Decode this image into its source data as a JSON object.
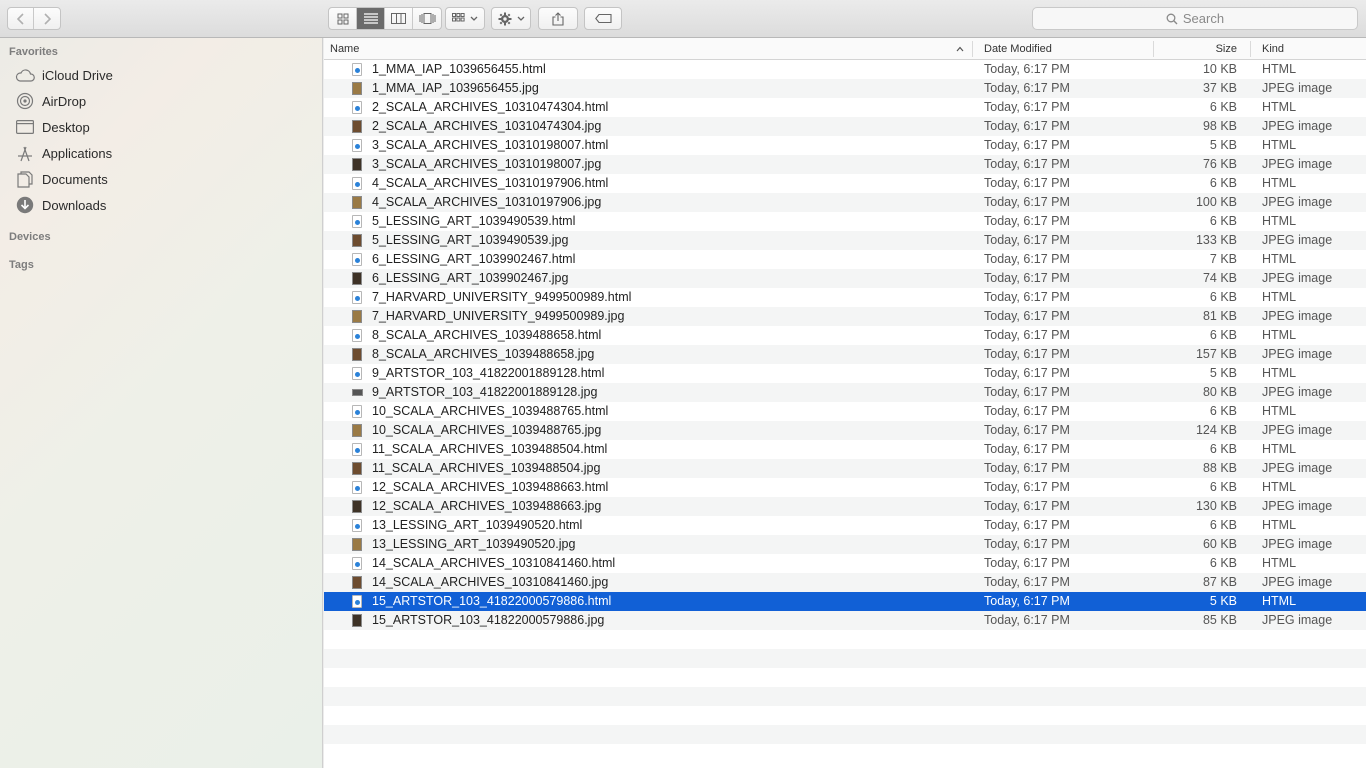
{
  "toolbar": {
    "back_icon": "chevron-left-icon",
    "forward_icon": "chevron-right-icon",
    "view_modes": [
      "icon-view",
      "list-view",
      "column-view",
      "cover-flow-view"
    ],
    "active_view": "list-view",
    "search_placeholder": "Search"
  },
  "sidebar": {
    "favorites_heading": "Favorites",
    "favorites": [
      {
        "label": "iCloud Drive",
        "icon": "cloud-icon"
      },
      {
        "label": "AirDrop",
        "icon": "airdrop-icon"
      },
      {
        "label": "Desktop",
        "icon": "desktop-icon"
      },
      {
        "label": "Applications",
        "icon": "applications-icon"
      },
      {
        "label": "Documents",
        "icon": "documents-icon"
      },
      {
        "label": "Downloads",
        "icon": "downloads-icon"
      }
    ],
    "devices_heading": "Devices",
    "tags_heading": "Tags"
  },
  "columns": {
    "name": "Name",
    "date": "Date Modified",
    "size": "Size",
    "kind": "Kind"
  },
  "files": [
    {
      "name": "1_MMA_IAP_1039656455.html",
      "date": "Today, 6:17 PM",
      "size": "10 KB",
      "kind": "HTML",
      "type": "html"
    },
    {
      "name": "1_MMA_IAP_1039656455.jpg",
      "date": "Today, 6:17 PM",
      "size": "37 KB",
      "kind": "JPEG image",
      "type": "jpg"
    },
    {
      "name": "2_SCALA_ARCHIVES_10310474304.html",
      "date": "Today, 6:17 PM",
      "size": "6 KB",
      "kind": "HTML",
      "type": "html"
    },
    {
      "name": "2_SCALA_ARCHIVES_10310474304.jpg",
      "date": "Today, 6:17 PM",
      "size": "98 KB",
      "kind": "JPEG image",
      "type": "jpg"
    },
    {
      "name": "3_SCALA_ARCHIVES_10310198007.html",
      "date": "Today, 6:17 PM",
      "size": "5 KB",
      "kind": "HTML",
      "type": "html"
    },
    {
      "name": "3_SCALA_ARCHIVES_10310198007.jpg",
      "date": "Today, 6:17 PM",
      "size": "76 KB",
      "kind": "JPEG image",
      "type": "jpg"
    },
    {
      "name": "4_SCALA_ARCHIVES_10310197906.html",
      "date": "Today, 6:17 PM",
      "size": "6 KB",
      "kind": "HTML",
      "type": "html"
    },
    {
      "name": "4_SCALA_ARCHIVES_10310197906.jpg",
      "date": "Today, 6:17 PM",
      "size": "100 KB",
      "kind": "JPEG image",
      "type": "jpg"
    },
    {
      "name": "5_LESSING_ART_1039490539.html",
      "date": "Today, 6:17 PM",
      "size": "6 KB",
      "kind": "HTML",
      "type": "html"
    },
    {
      "name": "5_LESSING_ART_1039490539.jpg",
      "date": "Today, 6:17 PM",
      "size": "133 KB",
      "kind": "JPEG image",
      "type": "jpg"
    },
    {
      "name": "6_LESSING_ART_1039902467.html",
      "date": "Today, 6:17 PM",
      "size": "7 KB",
      "kind": "HTML",
      "type": "html"
    },
    {
      "name": "6_LESSING_ART_1039902467.jpg",
      "date": "Today, 6:17 PM",
      "size": "74 KB",
      "kind": "JPEG image",
      "type": "jpg"
    },
    {
      "name": "7_HARVARD_UNIVERSITY_9499500989.html",
      "date": "Today, 6:17 PM",
      "size": "6 KB",
      "kind": "HTML",
      "type": "html"
    },
    {
      "name": "7_HARVARD_UNIVERSITY_9499500989.jpg",
      "date": "Today, 6:17 PM",
      "size": "81 KB",
      "kind": "JPEG image",
      "type": "jpg"
    },
    {
      "name": "8_SCALA_ARCHIVES_1039488658.html",
      "date": "Today, 6:17 PM",
      "size": "6 KB",
      "kind": "HTML",
      "type": "html"
    },
    {
      "name": "8_SCALA_ARCHIVES_1039488658.jpg",
      "date": "Today, 6:17 PM",
      "size": "157 KB",
      "kind": "JPEG image",
      "type": "jpg"
    },
    {
      "name": "9_ARTSTOR_103_41822001889128.html",
      "date": "Today, 6:17 PM",
      "size": "5 KB",
      "kind": "HTML",
      "type": "html"
    },
    {
      "name": "9_ARTSTOR_103_41822001889128.jpg",
      "date": "Today, 6:17 PM",
      "size": "80 KB",
      "kind": "JPEG image",
      "type": "jpg"
    },
    {
      "name": "10_SCALA_ARCHIVES_1039488765.html",
      "date": "Today, 6:17 PM",
      "size": "6 KB",
      "kind": "HTML",
      "type": "html"
    },
    {
      "name": "10_SCALA_ARCHIVES_1039488765.jpg",
      "date": "Today, 6:17 PM",
      "size": "124 KB",
      "kind": "JPEG image",
      "type": "jpg"
    },
    {
      "name": "11_SCALA_ARCHIVES_1039488504.html",
      "date": "Today, 6:17 PM",
      "size": "6 KB",
      "kind": "HTML",
      "type": "html"
    },
    {
      "name": "11_SCALA_ARCHIVES_1039488504.jpg",
      "date": "Today, 6:17 PM",
      "size": "88 KB",
      "kind": "JPEG image",
      "type": "jpg"
    },
    {
      "name": "12_SCALA_ARCHIVES_1039488663.html",
      "date": "Today, 6:17 PM",
      "size": "6 KB",
      "kind": "HTML",
      "type": "html"
    },
    {
      "name": "12_SCALA_ARCHIVES_1039488663.jpg",
      "date": "Today, 6:17 PM",
      "size": "130 KB",
      "kind": "JPEG image",
      "type": "jpg"
    },
    {
      "name": "13_LESSING_ART_1039490520.html",
      "date": "Today, 6:17 PM",
      "size": "6 KB",
      "kind": "HTML",
      "type": "html"
    },
    {
      "name": "13_LESSING_ART_1039490520.jpg",
      "date": "Today, 6:17 PM",
      "size": "60 KB",
      "kind": "JPEG image",
      "type": "jpg"
    },
    {
      "name": "14_SCALA_ARCHIVES_10310841460.html",
      "date": "Today, 6:17 PM",
      "size": "6 KB",
      "kind": "HTML",
      "type": "html"
    },
    {
      "name": "14_SCALA_ARCHIVES_10310841460.jpg",
      "date": "Today, 6:17 PM",
      "size": "87 KB",
      "kind": "JPEG image",
      "type": "jpg"
    },
    {
      "name": "15_ARTSTOR_103_41822000579886.html",
      "date": "Today, 6:17 PM",
      "size": "5 KB",
      "kind": "HTML",
      "type": "html",
      "selected": true
    },
    {
      "name": "15_ARTSTOR_103_41822000579886.jpg",
      "date": "Today, 6:17 PM",
      "size": "85 KB",
      "kind": "JPEG image",
      "type": "jpg"
    }
  ],
  "colors": {
    "selection": "#1160d6",
    "alt_row": "#f4f5f5"
  }
}
